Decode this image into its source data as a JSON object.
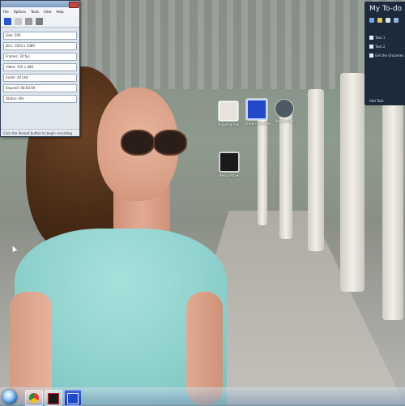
{
  "recorder_window": {
    "menu": [
      "File",
      "Options",
      "Tools",
      "View",
      "Help"
    ],
    "rows": [
      "Size: 500",
      "Dim: 1920 x 1080",
      "Frames: 30 fps",
      "Video: 720 x 480",
      "Audio: 44 kHz",
      "Elapsed: 00:00:00",
      "Status: Idle"
    ],
    "status": "Click the Record button to begin recording"
  },
  "gadget": {
    "title": "My To-do",
    "items": [
      "Task 1",
      "Task 2",
      "Get the Groceries"
    ],
    "footer": "Add Task"
  },
  "desktop_icons": [
    {
      "name": "icon-app-1",
      "label": "Snipping Tool",
      "color": "#e9e2dc"
    },
    {
      "name": "icon-app-2",
      "label": "Screen Recorder",
      "color": "#2349c8"
    },
    {
      "name": "icon-app-3",
      "label": "Recycle Bin",
      "color": "#4e5a62"
    },
    {
      "name": "icon-app-4",
      "label": "Media Player",
      "color": "#1a1a1a"
    }
  ],
  "taskbar": {
    "buttons": [
      "chrome",
      "video-player",
      "screen-recorder"
    ]
  },
  "colors": {
    "accent": "#2a56d6",
    "taskbar": "#8aa6c2",
    "gadget_bg": "#1c2a3b"
  }
}
